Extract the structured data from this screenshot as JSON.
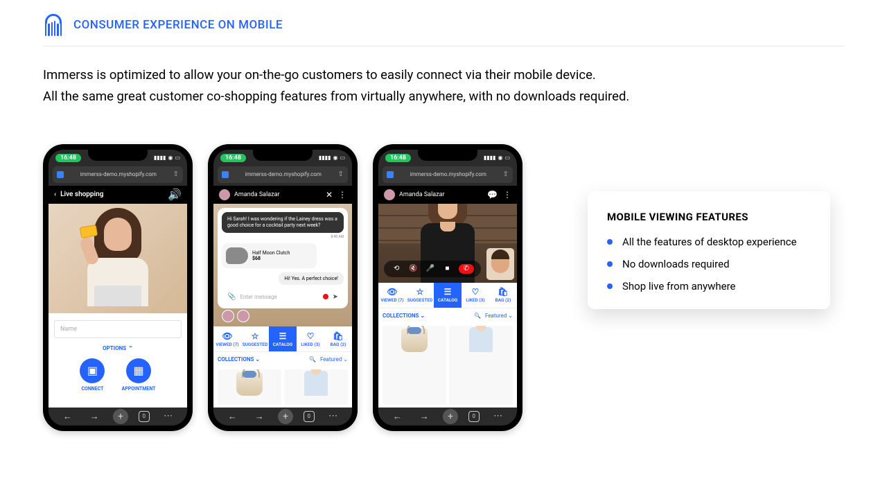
{
  "header": {
    "title": "CONSUMER EXPERIENCE ON MOBILE"
  },
  "intro": {
    "line1": "Immerss is optimized to allow your on-the-go customers to easily connect via    their mobile device.",
    "line2": "All the same great customer co-shopping features from virtually anywhere, with no downloads required."
  },
  "status": {
    "time": "16:48"
  },
  "url": "immerss-demo.myshopify.com",
  "bottom_nav_tabcount": "0",
  "phone1": {
    "title": "Live shopping",
    "name_placeholder": "Name",
    "options": "OPTIONS",
    "connect": "CONNECT",
    "appointment": "APPOINTMENT"
  },
  "phone2": {
    "agent_name": "Amanda Salazar",
    "msg_dark": "Hi Sarah!  I was wondering if the Lainey dress was a good choice for a cocktail party next week?",
    "msg_time": "8:40 AM",
    "product_name": "Half Moon Clutch",
    "product_price": "$68",
    "msg_reply": "Hi!  Yes.  A perfect choice!",
    "input_placeholder": "Enter message"
  },
  "phone3": {
    "agent_name": "Amanda Salazar"
  },
  "tabs": {
    "viewed": "VIEWED (7)",
    "suggested": "SUGGESTED",
    "catalog": "CATALOG",
    "liked": "LIKED (3)",
    "bag": "BAG (2)"
  },
  "collections": {
    "label": "COLLECTIONS",
    "featured": "Featured"
  },
  "features": {
    "title": "MOBILE VIEWING FEATURES",
    "items": [
      "All the features of desktop experience",
      "No downloads required",
      "Shop live from anywhere"
    ]
  }
}
